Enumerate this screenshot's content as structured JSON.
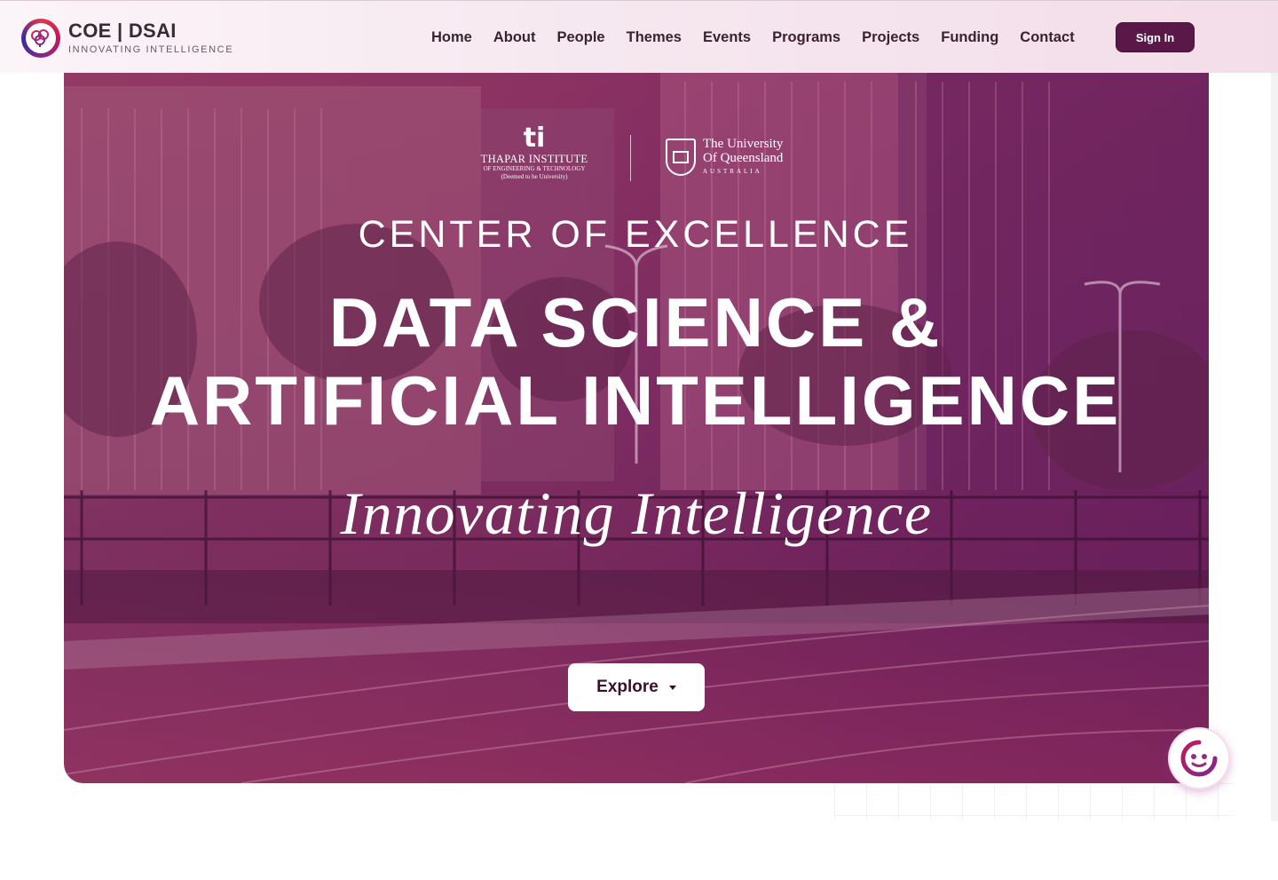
{
  "brand": {
    "title": "COE | DSAI",
    "subtitle": "INNOVATING INTELLIGENCE",
    "logo_icon": "brain-icon"
  },
  "nav": {
    "items": [
      {
        "label": "Home"
      },
      {
        "label": "About"
      },
      {
        "label": "People"
      },
      {
        "label": "Themes"
      },
      {
        "label": "Events"
      },
      {
        "label": "Programs"
      },
      {
        "label": "Projects"
      },
      {
        "label": "Funding"
      },
      {
        "label": "Contact"
      }
    ],
    "sign_in_label": "Sign In"
  },
  "hero": {
    "partner_ti": {
      "mark": "ti",
      "name": "THAPAR INSTITUTE",
      "sub1": "OF ENGINEERING & TECHNOLOGY",
      "sub2": "(Deemed to be University)"
    },
    "partner_uq": {
      "line1": "The University",
      "line2": "Of Queensland",
      "line3": "AUSTRALIA"
    },
    "eyebrow": "CENTER OF EXCELLENCE",
    "title_line1": "DATA SCIENCE &",
    "title_line2": "ARTIFICIAL INTELLIGENCE",
    "tagline": "Innovating Intelligence",
    "explore_label": "Explore"
  },
  "chat": {
    "icon": "chatbot-face-icon"
  },
  "colors": {
    "accent": "#5a1848",
    "hero_overlay": "#8d3f6c"
  }
}
